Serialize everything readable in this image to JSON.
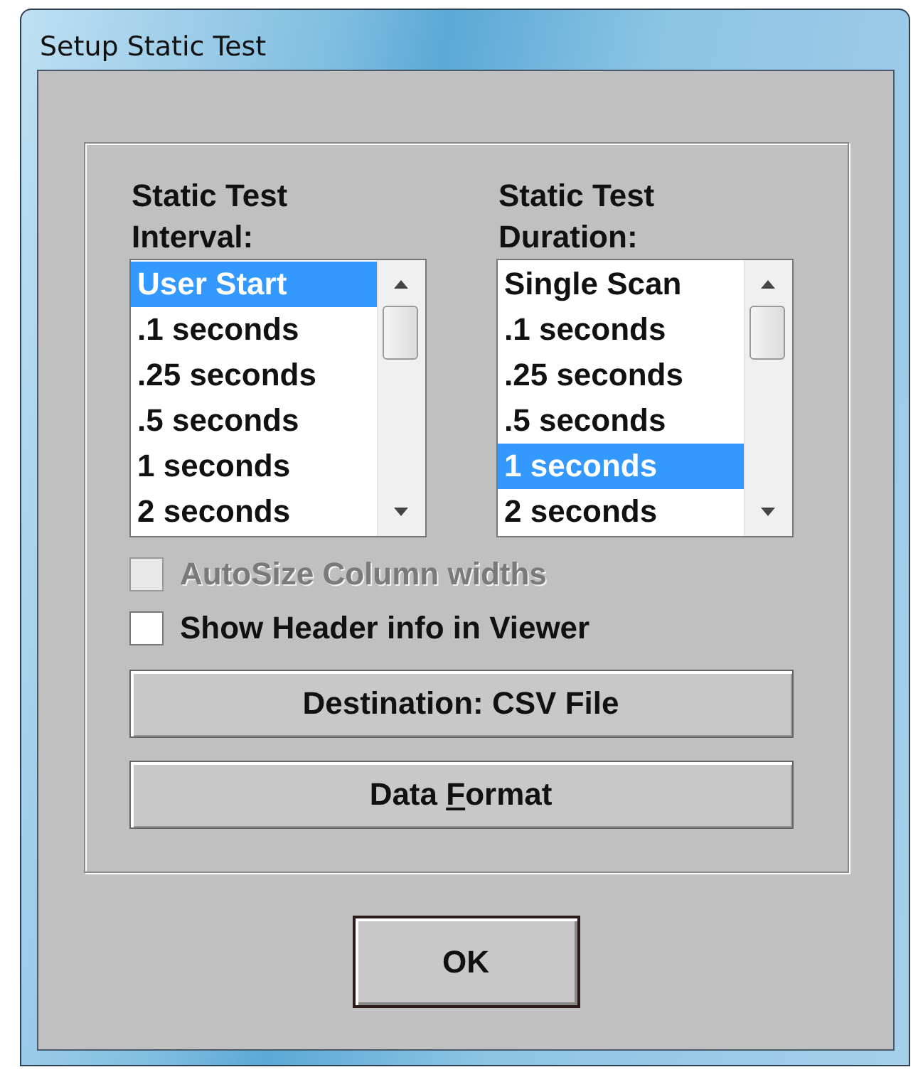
{
  "window": {
    "title": "Setup Static Test"
  },
  "lists": [
    {
      "label": "Static Test Interval:",
      "items": [
        {
          "text": "User Start",
          "selected": true
        },
        {
          "text": ".1 seconds",
          "selected": false
        },
        {
          "text": ".25 seconds",
          "selected": false
        },
        {
          "text": ".5 seconds",
          "selected": false
        },
        {
          "text": "1 seconds",
          "selected": false
        },
        {
          "text": "2 seconds",
          "selected": false
        }
      ]
    },
    {
      "label": "Static Test Duration:",
      "items": [
        {
          "text": "Single Scan",
          "selected": false
        },
        {
          "text": ".1 seconds",
          "selected": false
        },
        {
          "text": ".25 seconds",
          "selected": false
        },
        {
          "text": ".5 seconds",
          "selected": false
        },
        {
          "text": "1 seconds",
          "selected": true
        },
        {
          "text": "2 seconds",
          "selected": false
        }
      ]
    }
  ],
  "checkboxes": [
    {
      "label": "AutoSize Column widths",
      "checked": false,
      "disabled": true
    },
    {
      "label": "Show Header info in Viewer",
      "checked": false,
      "disabled": false
    }
  ],
  "buttons": [
    {
      "label": "Destination: CSV File"
    },
    {
      "label_before_access_key": "Data ",
      "access_key": "F",
      "label_after_access_key": "ormat"
    }
  ],
  "ok_button": {
    "label": "OK"
  }
}
